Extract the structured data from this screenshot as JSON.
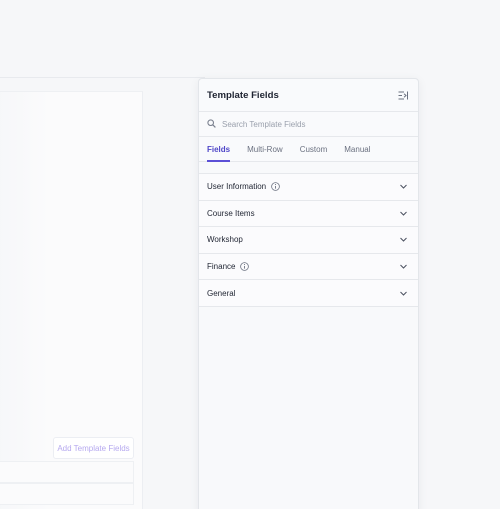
{
  "background": {
    "add_button_label": "Add Template Fields"
  },
  "panel": {
    "title": "Template Fields",
    "collapse_icon": "collapse-panel-icon",
    "search": {
      "placeholder": "Search Template Fields",
      "value": ""
    },
    "tabs": [
      {
        "label": "Fields",
        "active": true
      },
      {
        "label": "Multi-Row",
        "active": false
      },
      {
        "label": "Custom",
        "active": false
      },
      {
        "label": "Manual",
        "active": false
      }
    ],
    "sections": [
      {
        "label": "User Information",
        "info": true
      },
      {
        "label": "Course Items",
        "info": false
      },
      {
        "label": "Workshop",
        "info": false
      },
      {
        "label": "Finance",
        "info": true
      },
      {
        "label": "General",
        "info": false
      }
    ]
  },
  "colors": {
    "accent": "#5b4fd6",
    "text": "#1e2331",
    "muted": "#6b7180",
    "border": "#e6e8ec"
  }
}
